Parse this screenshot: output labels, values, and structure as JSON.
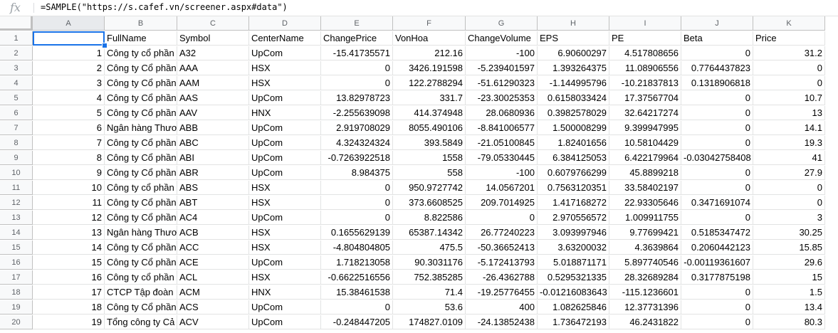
{
  "formula_bar": {
    "fx_label": "fx",
    "formula": "=SAMPLE(\"https://s.cafef.vn/screener.aspx#data\")"
  },
  "columns": [
    "A",
    "B",
    "C",
    "D",
    "E",
    "F",
    "G",
    "H",
    "I",
    "J",
    "K"
  ],
  "rows": [
    [
      "",
      "FullName",
      "Symbol",
      "CenterName",
      "ChangePrice",
      "VonHoa",
      "ChangeVolume",
      "EPS",
      "PE",
      "Beta",
      "Price"
    ],
    [
      "1",
      "Công ty cổ phần",
      "A32",
      "UpCom",
      "-15.41735571",
      "212.16",
      "-100",
      "6.90600297",
      "4.517808656",
      "0",
      "31.2"
    ],
    [
      "2",
      "Công ty Cổ phần",
      "AAA",
      "HSX",
      "0",
      "3426.191598",
      "-5.239401597",
      "1.393264375",
      "11.08906556",
      "0.7764437823",
      "0"
    ],
    [
      "3",
      "Công ty Cổ phần",
      "AAM",
      "HSX",
      "0",
      "122.2788294",
      "-51.61290323",
      "-1.144995796",
      "-10.21837813",
      "0.1318906818",
      "0"
    ],
    [
      "4",
      "Công ty Cổ phần",
      "AAS",
      "UpCom",
      "13.82978723",
      "331.7",
      "-23.30025353",
      "0.6158033424",
      "17.37567704",
      "0",
      "10.7"
    ],
    [
      "5",
      "Công ty Cổ phần",
      "AAV",
      "HNX",
      "-2.255639098",
      "414.374948",
      "28.0680936",
      "0.3982578029",
      "32.64217274",
      "0",
      "13"
    ],
    [
      "6",
      "Ngân hàng Thươ",
      "ABB",
      "UpCom",
      "2.919708029",
      "8055.490106",
      "-8.841006577",
      "1.500008299",
      "9.399947995",
      "0",
      "14.1"
    ],
    [
      "7",
      "Công ty Cổ phần",
      "ABC",
      "UpCom",
      "4.324324324",
      "393.5849",
      "-21.05100845",
      "1.82401656",
      "10.58104429",
      "0",
      "19.3"
    ],
    [
      "8",
      "Công ty Cổ phần",
      "ABI",
      "UpCom",
      "-0.7263922518",
      "1558",
      "-79.05330445",
      "6.384125053",
      "6.422179964",
      "-0.03042758408",
      "41"
    ],
    [
      "9",
      "Công ty Cổ phần",
      "ABR",
      "UpCom",
      "8.984375",
      "558",
      "-100",
      "0.6079766299",
      "45.8899218",
      "0",
      "27.9"
    ],
    [
      "10",
      "Công ty cổ phần",
      "ABS",
      "HSX",
      "0",
      "950.9727742",
      "14.0567201",
      "0.7563120351",
      "33.58402197",
      "0",
      "0"
    ],
    [
      "11",
      "Công ty Cổ phần",
      "ABT",
      "HSX",
      "0",
      "373.6608525",
      "209.7014925",
      "1.417168272",
      "22.93305646",
      "0.3471691074",
      "0"
    ],
    [
      "12",
      "Công ty Cổ phần",
      "AC4",
      "UpCom",
      "0",
      "8.822586",
      "0",
      "2.970556572",
      "1.009911755",
      "0",
      "3"
    ],
    [
      "13",
      "Ngân hàng Thươ",
      "ACB",
      "HSX",
      "0.1655629139",
      "65387.14342",
      "26.77240223",
      "3.093997946",
      "9.77699421",
      "0.5185347472",
      "30.25"
    ],
    [
      "14",
      "Công ty Cổ phần",
      "ACC",
      "HSX",
      "-4.804804805",
      "475.5",
      "-50.36652413",
      "3.63200032",
      "4.3639864",
      "0.2060442123",
      "15.85"
    ],
    [
      "15",
      "Công ty Cổ phần",
      "ACE",
      "UpCom",
      "1.718213058",
      "90.3031176",
      "-5.172413793",
      "5.018871171",
      "5.897740546",
      "-0.00119361607",
      "29.6"
    ],
    [
      "16",
      "Công ty cổ phần",
      "ACL",
      "HSX",
      "-0.6622516556",
      "752.385285",
      "-26.4362788",
      "0.5295321335",
      "28.32689284",
      "0.3177875198",
      "15"
    ],
    [
      "17",
      "CTCP Tập đoàn",
      "ACM",
      "HNX",
      "15.38461538",
      "71.4",
      "-19.25776455",
      "-0.01216083643",
      "-115.1236601",
      "0",
      "1.5"
    ],
    [
      "18",
      "Công ty Cổ phần",
      "ACS",
      "UpCom",
      "0",
      "53.6",
      "400",
      "1.082625846",
      "12.37731396",
      "0",
      "13.4"
    ],
    [
      "19",
      "Tổng công ty Cả",
      "ACV",
      "UpCom",
      "-0.248447205",
      "174827.0109",
      "-24.13852438",
      "1.736472193",
      "46.2431822",
      "0",
      "80.3"
    ]
  ],
  "row_numbers": [
    "1",
    "2",
    "3",
    "4",
    "5",
    "6",
    "7",
    "8",
    "9",
    "10",
    "11",
    "12",
    "13",
    "14",
    "15",
    "16",
    "17",
    "18",
    "19",
    "20"
  ],
  "colors": {
    "selection": "#1a73e8",
    "header_bg": "#f8f9fa",
    "gridline": "#e2e3e3"
  }
}
